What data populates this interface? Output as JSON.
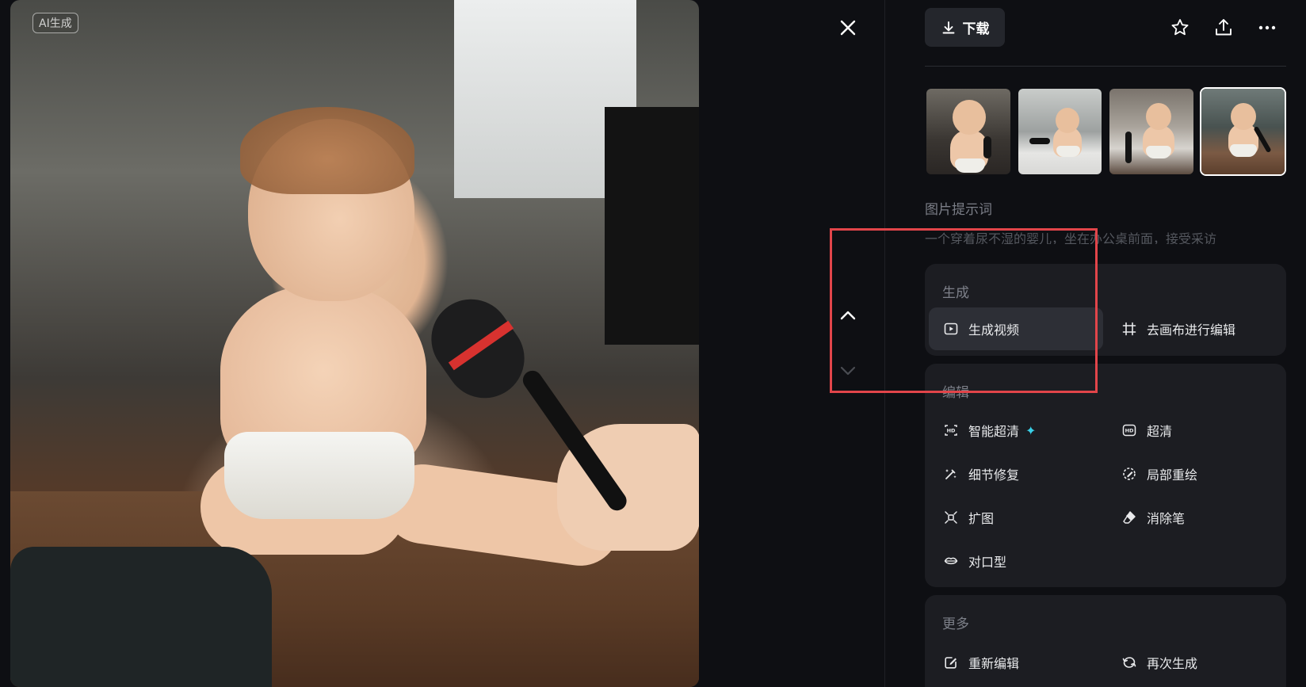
{
  "viewer": {
    "badge": "AI生成"
  },
  "header": {
    "download_label": "下载"
  },
  "prompt": {
    "label": "图片提示词",
    "text": "一个穿着尿不湿的婴儿，坐在办公桌前面，接受采访"
  },
  "sections": {
    "generate": {
      "title": "生成",
      "items": [
        {
          "label": "生成视频",
          "icon": "play-video-icon"
        },
        {
          "label": "去画布进行编辑",
          "icon": "crop-canvas-icon"
        }
      ]
    },
    "edit": {
      "title": "编辑",
      "items": [
        {
          "label": "智能超清",
          "icon": "hd-plus-icon"
        },
        {
          "label": "超清",
          "icon": "hd-icon"
        },
        {
          "label": "细节修复",
          "icon": "magic-wand-icon"
        },
        {
          "label": "局部重绘",
          "icon": "partial-redraw-icon"
        },
        {
          "label": "扩图",
          "icon": "expand-icon"
        },
        {
          "label": "消除笔",
          "icon": "eraser-icon"
        },
        {
          "label": "对口型",
          "icon": "lips-icon"
        }
      ]
    },
    "more": {
      "title": "更多",
      "items": [
        {
          "label": "重新编辑",
          "icon": "re-edit-icon"
        },
        {
          "label": "再次生成",
          "icon": "regenerate-icon"
        }
      ]
    }
  },
  "colors": {
    "accent_highlight": "#e2454a",
    "sparkle": "#39d0e8",
    "panel_bg": "#0e0f13",
    "card_bg": "#1c1d22"
  }
}
